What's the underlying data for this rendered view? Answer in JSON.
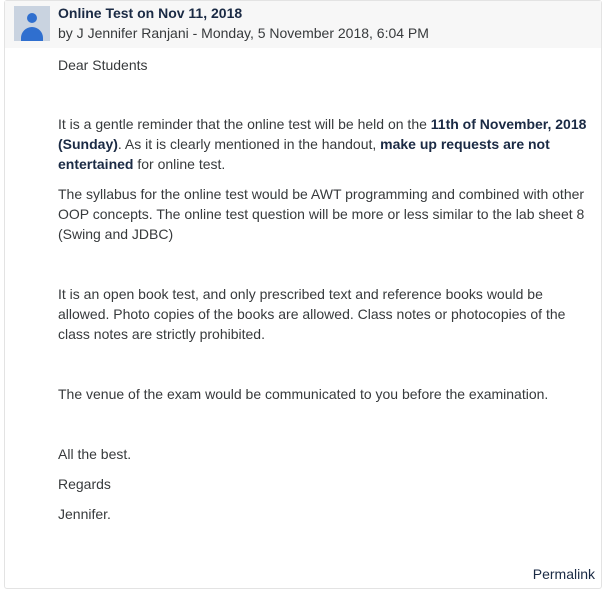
{
  "post": {
    "subject": "Online Test on Nov 11, 2018",
    "author_line": "by J Jennifer Ranjani - Monday, 5 November 2018, 6:04 PM",
    "greeting": "Dear Students",
    "reminder": {
      "t1": "It is a gentle reminder that the online test will be held on the ",
      "b1": "11th of November, 2018 (Sunday)",
      "t2": ". As it is clearly mentioned in the handout, ",
      "b2": "make up requests are not entertained",
      "t3": " for online test."
    },
    "syllabus": "The syllabus for the online test would be AWT programming and combined with other OOP concepts. The online test question will be more or less similar to the lab sheet 8 (Swing and JDBC)",
    "open_book": "It is an open book test, and only prescribed text and reference books would be allowed. Photo copies of the books are allowed. Class notes or photocopies of the class notes  are strictly prohibited.",
    "venue": "The venue of the exam would be communicated to you before the examination.",
    "best": "All the best.",
    "regards": "Regards",
    "signature": "Jennifer.",
    "permalink": "Permalink"
  },
  "colors": {
    "header_bg": "#f7f7f7",
    "avatar_bg": "#c9d3e0",
    "avatar_fg": "#2f6fcf",
    "title_text": "#1a2a44",
    "body_text": "#373a3c"
  }
}
